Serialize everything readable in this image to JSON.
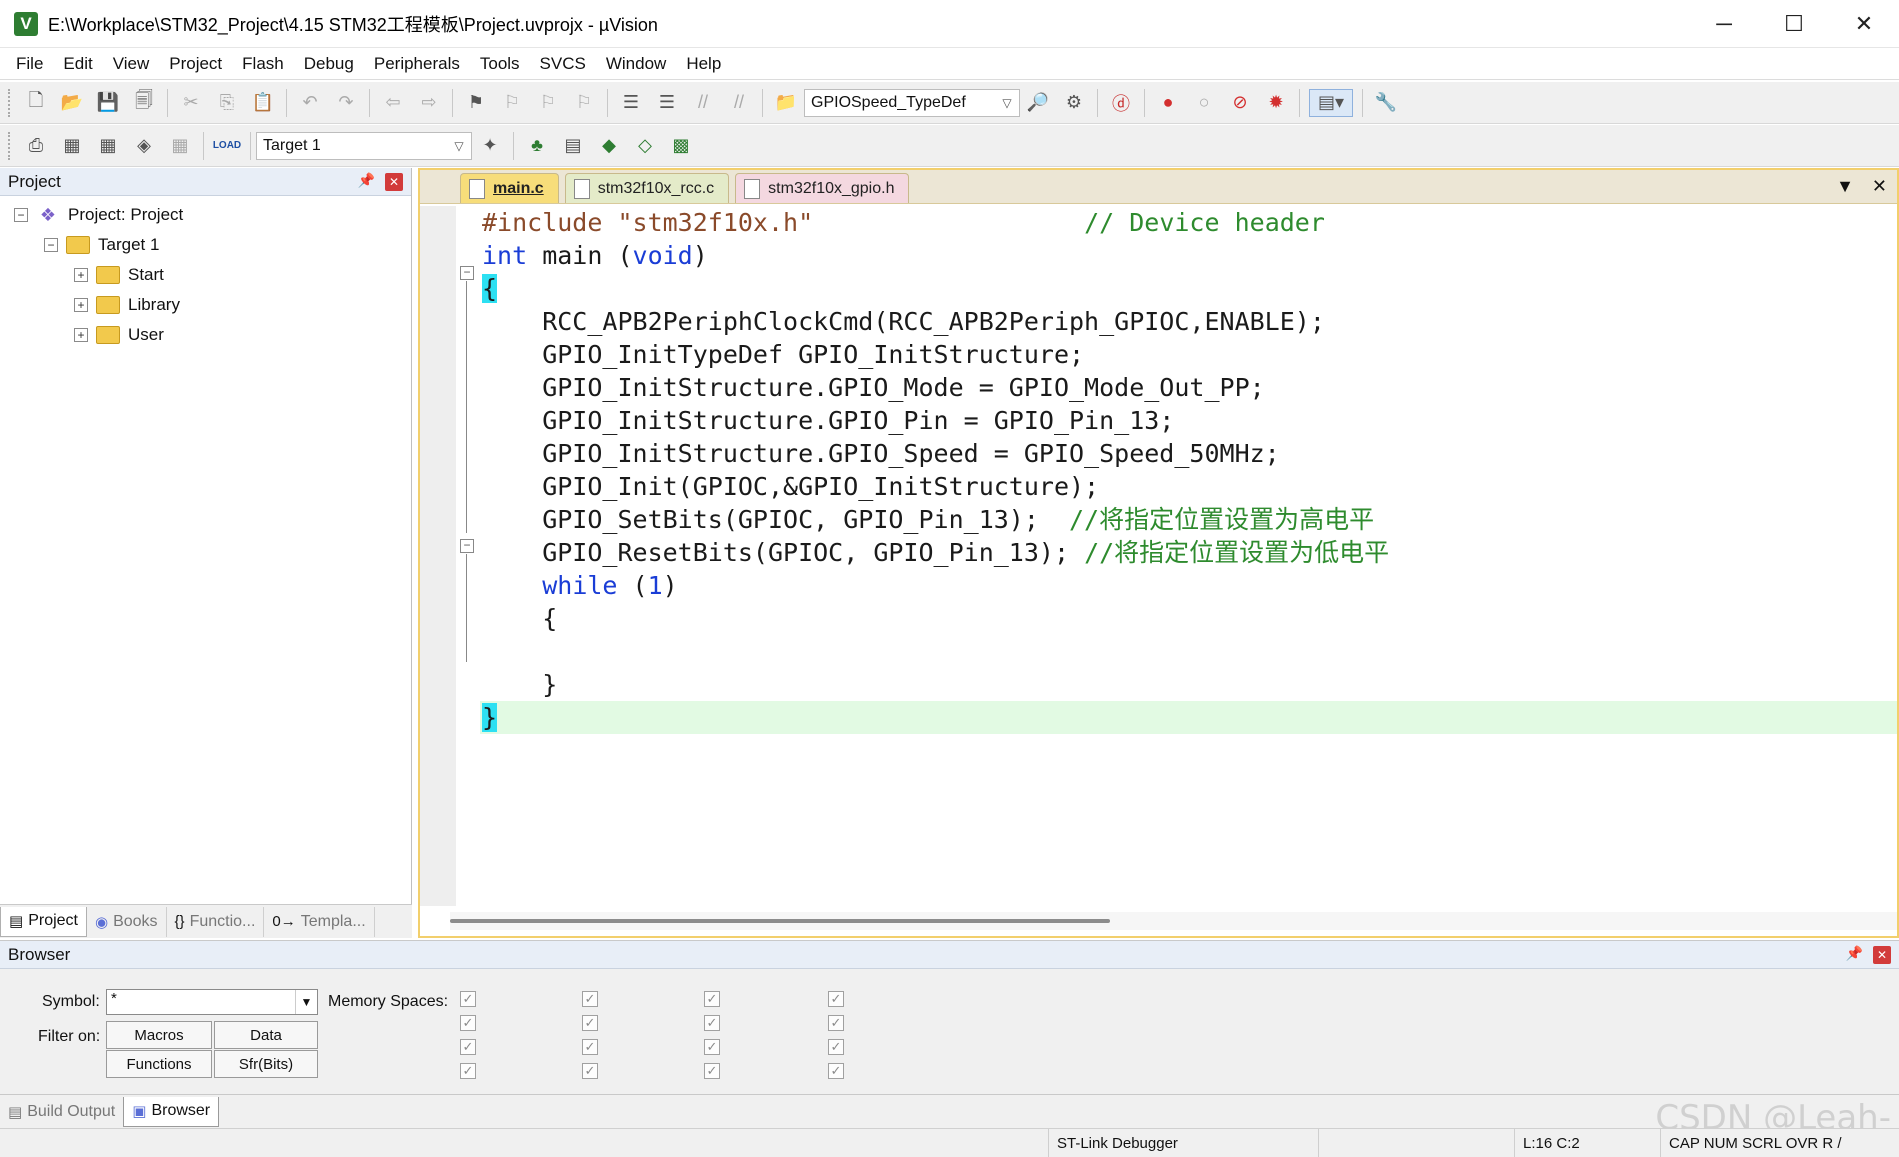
{
  "window": {
    "title": "E:\\Workplace\\STM32_Project\\4.15 STM32工程模板\\Project.uvprojx - µVision",
    "app_icon": "V",
    "minimize": "─",
    "maximize": "☐",
    "close": "✕"
  },
  "menu": [
    "File",
    "Edit",
    "View",
    "Project",
    "Flash",
    "Debug",
    "Peripherals",
    "Tools",
    "SVCS",
    "Window",
    "Help"
  ],
  "toolbar": {
    "find_combo_value": "GPIOSpeed_TypeDef",
    "target_combo_value": "Target 1",
    "load_label": "LOAD"
  },
  "project_panel": {
    "title": "Project",
    "tree": [
      {
        "label": "Project: Project",
        "level": 0,
        "expander": "−"
      },
      {
        "label": "Target 1",
        "level": 1,
        "expander": "−"
      },
      {
        "label": "Start",
        "level": 2,
        "expander": "+"
      },
      {
        "label": "Library",
        "level": 2,
        "expander": "+"
      },
      {
        "label": "User",
        "level": 2,
        "expander": "+"
      }
    ],
    "tabs": [
      "Project",
      "Books",
      "Functio...",
      "Templa..."
    ]
  },
  "editor": {
    "tabs": [
      "main.c",
      "stm32f10x_rcc.c",
      "stm32f10x_gpio.h"
    ],
    "active_tab": "main.c",
    "code": {
      "l1_pp": "#include ",
      "l1_str": "\"stm32f10x.h\"",
      "l1_pad": "                  ",
      "l1_cm": "// Device header",
      "l2_kw1": "int",
      "l2_mid": " main (",
      "l2_kw2": "void",
      "l2_end": ")",
      "l3": "{",
      "l4": "    RCC_APB2PeriphClockCmd(RCC_APB2Periph_GPIOC,ENABLE);",
      "l5": "    GPIO_InitTypeDef GPIO_InitStructure;",
      "l6": "    GPIO_InitStructure.GPIO_Mode = GPIO_Mode_Out_PP;",
      "l7": "    GPIO_InitStructure.GPIO_Pin = GPIO_Pin_13;",
      "l8": "    GPIO_InitStructure.GPIO_Speed = GPIO_Speed_50MHz;",
      "l9": "    GPIO_Init(GPIOC,&GPIO_InitStructure);",
      "l10_code": "    GPIO_SetBits(GPIOC, GPIO_Pin_13);  ",
      "l10_cm": "//将指定位置设置为高电平",
      "l11_code": "    GPIO_ResetBits(GPIOC, GPIO_Pin_13); ",
      "l11_cm": "//将指定位置设置为低电平",
      "l12_indent": "    ",
      "l12_kw": "while",
      "l12_mid": " (",
      "l12_num": "1",
      "l12_end": ")",
      "l13": "    {",
      "l14": "",
      "l15": "    }",
      "l16": "}"
    }
  },
  "browser": {
    "title": "Browser",
    "symbol_label": "Symbol:",
    "symbol_value": "*",
    "filter_label": "Filter on:",
    "memory_label": "Memory Spaces:",
    "filter_buttons": [
      "Macros",
      "Data",
      "Functions",
      "Sfr(Bits)"
    ],
    "check_mark": "✓",
    "tabs": [
      "Build Output",
      "Browser"
    ]
  },
  "status": {
    "debugger": "ST-Link Debugger",
    "position": "L:16 C:2",
    "indicators": "CAP  NUM  SCRL  OVR  R /"
  },
  "watermark": "CSDN @Leah-"
}
